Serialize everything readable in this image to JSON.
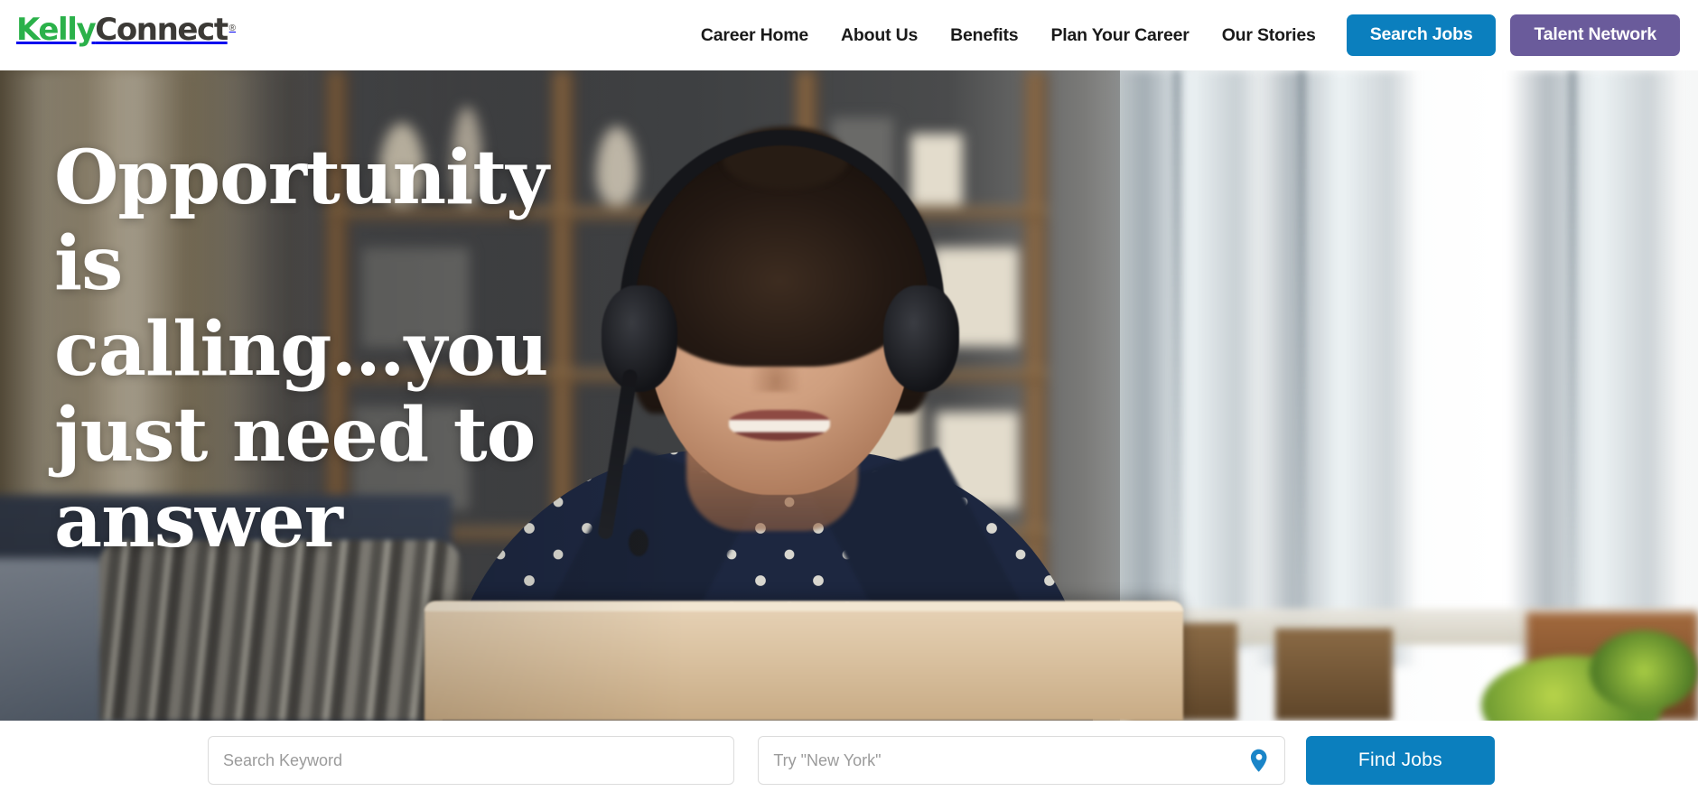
{
  "brand": {
    "name_part1": "Kelly",
    "name_part2": "Connect",
    "trademark": "®",
    "green": "#2bb14a",
    "dark": "#3c3a36"
  },
  "header": {
    "nav_items": [
      {
        "label": "Career Home"
      },
      {
        "label": "About Us"
      },
      {
        "label": "Benefits"
      },
      {
        "label": "Plan Your Career"
      },
      {
        "label": "Our Stories"
      }
    ],
    "buttons": [
      {
        "label": "Search Jobs",
        "color": "#0b7fbe"
      },
      {
        "label": "Talent Network",
        "color": "#6a5b9b"
      }
    ]
  },
  "hero": {
    "headline_line1": "Opportunity is",
    "headline_line2": "calling…you",
    "headline_line3": "just need to",
    "headline_line4": "answer",
    "image_description": "Smiling woman wearing a black headset with boom microphone, working on a laptop at home"
  },
  "search": {
    "keyword_placeholder": "Search Keyword",
    "keyword_value": "",
    "location_placeholder": "Try \"New York\"",
    "location_value": "",
    "location_icon": "map-pin-icon",
    "location_icon_color": "#1a85c8",
    "submit_label": "Find Jobs",
    "submit_color": "#0b7fbe"
  }
}
